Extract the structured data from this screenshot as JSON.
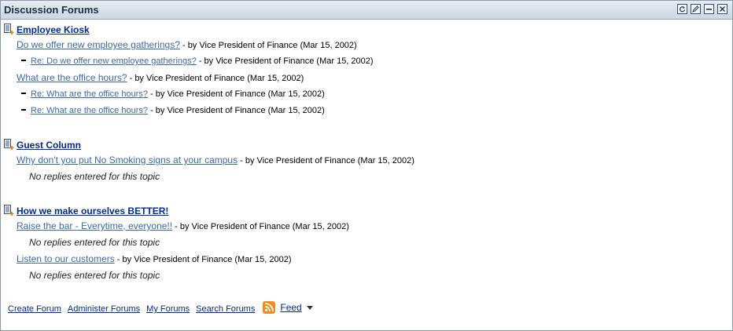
{
  "portlet": {
    "title": "Discussion Forums",
    "buttons": [
      "refresh-icon",
      "edit-icon",
      "minimize-icon",
      "close-icon"
    ]
  },
  "forums": [
    {
      "title": "Employee Kiosk",
      "topics": [
        {
          "title": "Do we offer new employee gatherings?",
          "meta": "- by Vice President of Finance (Mar 15, 2002)",
          "replies": [
            {
              "title": "Re: Do we offer new employee gatherings?",
              "meta": "- by Vice President of Finance (Mar 15, 2002)"
            }
          ]
        },
        {
          "title": "What are the office hours?",
          "meta": "- by Vice President of Finance (Mar 15, 2002)",
          "replies": [
            {
              "title": "Re: What are the office hours?",
              "meta": "- by Vice President of Finance (Mar 15, 2002)"
            },
            {
              "title": "Re: What are the office hours?",
              "meta": "- by Vice President of Finance (Mar 15, 2002)"
            }
          ]
        }
      ]
    },
    {
      "title": "Guest Column",
      "topics": [
        {
          "title": "Why don't you put No Smoking signs at your campus",
          "meta": "- by Vice President of Finance (Mar 15, 2002)",
          "no_replies": "No replies entered for this topic"
        }
      ]
    },
    {
      "title": "How we make ourselves BETTER!",
      "topics": [
        {
          "title": "Raise the bar - Everytime, everyone!!",
          "meta": "- by Vice President of Finance (Mar 15, 2002)",
          "no_replies": "No replies entered for this topic"
        },
        {
          "title": "Listen to our customers",
          "meta": "- by Vice President of Finance (Mar 15, 2002)",
          "no_replies": "No replies entered for this topic"
        }
      ]
    }
  ],
  "footer": {
    "links": [
      "Create Forum",
      "Administer Forums",
      "My Forums",
      "Search Forums"
    ],
    "feed_label": "Feed"
  },
  "colors": {
    "link": "#3b69a8",
    "forum_title": "#002a96",
    "rss": "#f28c1a"
  }
}
